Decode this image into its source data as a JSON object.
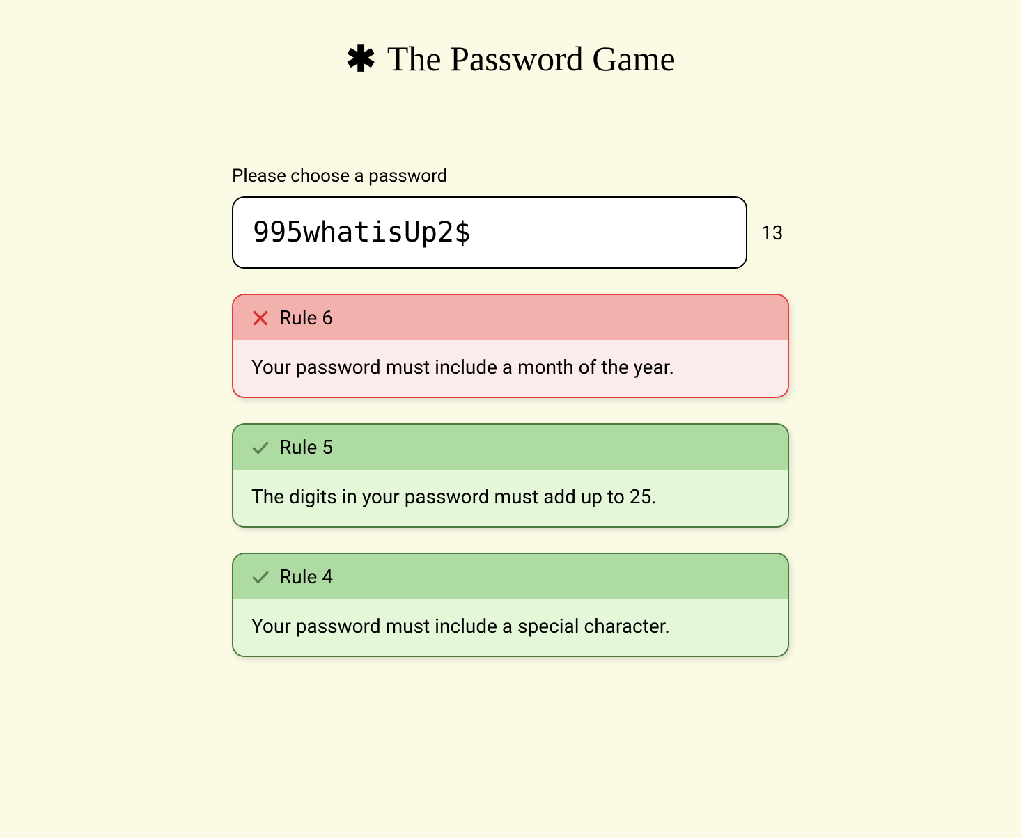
{
  "title": "The Password Game",
  "prompt": "Please choose a password",
  "password": {
    "value": "995whatisUp2$",
    "length": "13"
  },
  "rules": [
    {
      "status": "fail",
      "label": "Rule 6",
      "description": "Your password must include a month of the year."
    },
    {
      "status": "pass",
      "label": "Rule 5",
      "description": "The digits in your password must add up to 25."
    },
    {
      "status": "pass",
      "label": "Rule 4",
      "description": "Your password must include a special character."
    }
  ]
}
